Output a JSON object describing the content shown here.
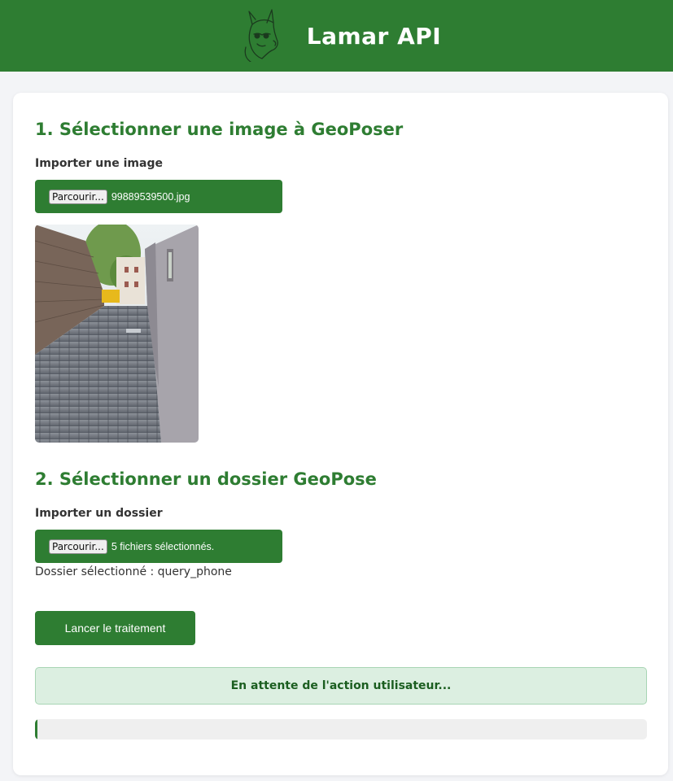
{
  "header": {
    "title": "Lamar API",
    "logo_icon": "llama-icon"
  },
  "section1": {
    "title": "1. Sélectionner une image à GeoPoser",
    "field_label": "Importer une image",
    "browse_label": "Parcourir...",
    "file_status": "99889539500.jpg",
    "preview": "street-photo"
  },
  "section2": {
    "title": "2. Sélectionner un dossier GeoPose",
    "field_label": "Importer un dossier",
    "browse_label": "Parcourir...",
    "file_status": "5 fichiers sélectionnés.",
    "folder_info": "Dossier sélectionné : query_phone"
  },
  "actions": {
    "launch_label": "Lancer le traitement"
  },
  "status": {
    "message": "En attente de l'action utilisateur..."
  },
  "progress": {
    "percent": 0
  },
  "colors": {
    "primary": "#2e7d32",
    "status_bg": "#dcefe1",
    "status_text": "#1b5e20"
  }
}
